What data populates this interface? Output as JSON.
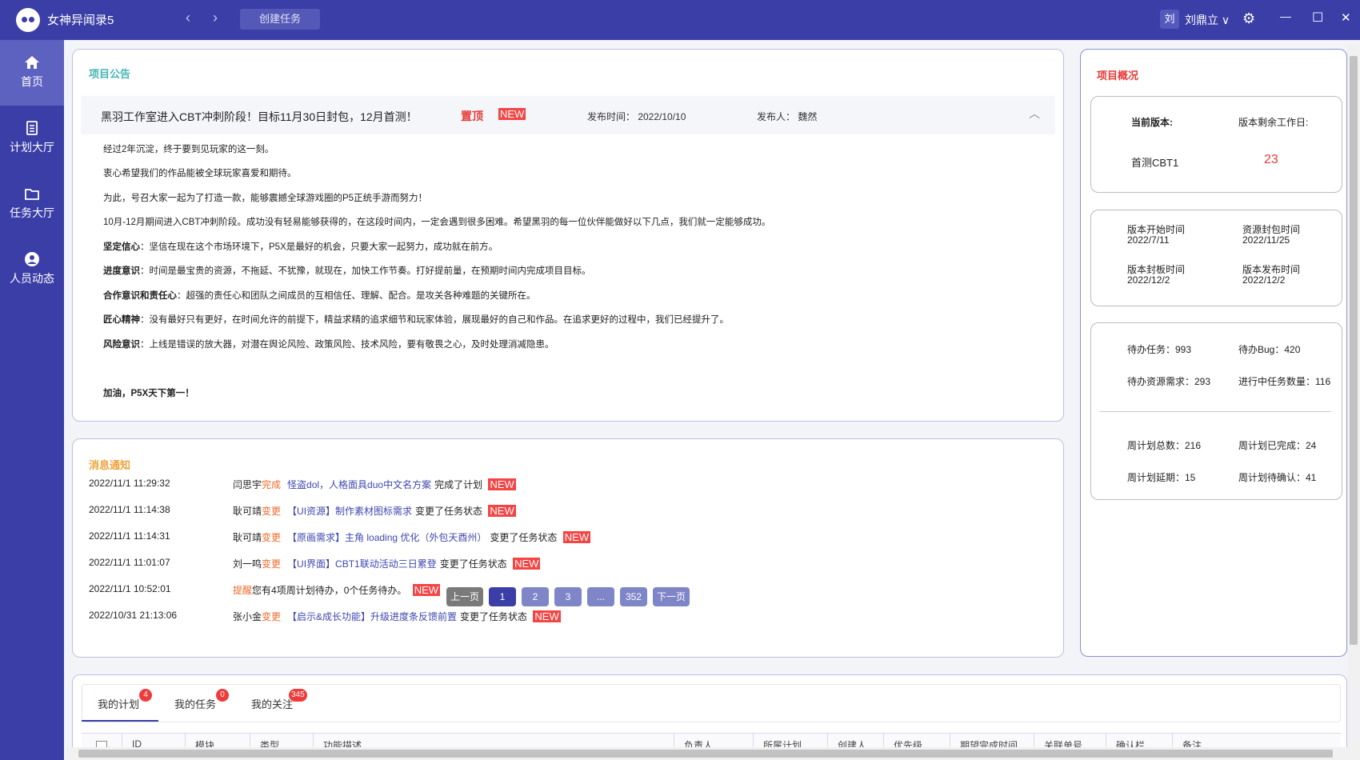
{
  "titlebar": {
    "app_title": "女神异闻录5",
    "back_arrow": "‹",
    "forward_arrow": "›",
    "create_task": "创建任务",
    "user_avatar": "刘",
    "user_name": "刘鼎立 ∨",
    "settings_glyph": "⚙",
    "minimize_glyph": "—",
    "maximize_glyph": "☐",
    "close_glyph": "✕"
  },
  "sidebar": {
    "items": [
      {
        "label": "首页"
      },
      {
        "label": "计划大厅"
      },
      {
        "label": "任务大厅"
      },
      {
        "label": "人员动态"
      }
    ]
  },
  "announcement": {
    "section_title": "项目公告",
    "title": "黑羽工作室进入CBT冲刺阶段！目标11月30日封包，12月首测！",
    "tag_top": "置顶",
    "tag_new": "NEW",
    "date": "发布时间：  2022/10/10",
    "author": "发布人：  魏然",
    "chevron": "︿",
    "lines": [
      {
        "bold": "",
        "text": "经过2年沉淀，终于要到见玩家的这一刻。"
      },
      {
        "bold": "",
        "text": "衷心希望我们的作品能被全球玩家喜爱和期待。"
      },
      {
        "bold": "",
        "text": "为此，号召大家一起为了打造一款，能够震撼全球游戏圈的P5正统手游而努力！"
      },
      {
        "bold": "",
        "text": "10月-12月期间进入CBT冲刺阶段。成功没有轻易能够获得的，在这段时间内，一定会遇到很多困难。希望黑羽的每一位伙伴能做好以下几点，我们就一定能够成功。"
      },
      {
        "bold": "坚定信心",
        "text": "：坚信在现在这个市场环境下，P5X是最好的机会，只要大家一起努力，成功就在前方。"
      },
      {
        "bold": "进度意识",
        "text": "：时间是最宝贵的资源，不拖延、不犹豫，就现在，加快工作节奏。打好提前量，在预期时间内完成项目目标。"
      },
      {
        "bold": "合作意识和责任心",
        "text": "：超强的责任心和团队之间成员的互相信任、理解、配合。是攻关各种难题的关键所在。"
      },
      {
        "bold": "匠心精神",
        "text": "：没有最好只有更好，在时间允许的前提下，精益求精的追求细节和玩家体验，展现最好的自己和作品。在追求更好的过程中，我们已经提升了。"
      },
      {
        "bold": "风险意识",
        "text": "：上线是错误的放大器，对潜在舆论风险、政策风险、技术风险，要有敬畏之心，及时处理消减隐患。"
      }
    ],
    "closing": "加油，P5X天下第一！"
  },
  "messages": {
    "section_title": "消息通知",
    "rows": [
      {
        "time": "2022/11/1 11:29:32",
        "user": "闫思宇",
        "action": "完成",
        "link": "怪盗dol，人格面具duo中文名方案",
        "result": "完成了计划",
        "badge": "NEW"
      },
      {
        "time": "2022/11/1 11:14:38",
        "user": "耿可靖",
        "action": "变更",
        "link": "【UI资源】制作素材图标需求",
        "result": "变更了任务状态",
        "badge": "NEW"
      },
      {
        "time": "2022/11/1 11:14:31",
        "user": "耿可靖",
        "action": "变更",
        "link": "【原画需求】主角 loading 优化（外包天酉州）",
        "result": "变更了任务状态",
        "badge": "NEW"
      },
      {
        "time": "2022/11/1 11:01:07",
        "user": "刘一鸣",
        "action": "变更",
        "link": "【UI界面】CBT1联动活动三日累登",
        "result": "变更了任务状态",
        "badge": "NEW"
      },
      {
        "time": "2022/11/1 10:52:01",
        "user": "",
        "action": "提醒",
        "link": "",
        "result": "您有4项周计划待办，0个任务待办。",
        "badge": "NEW"
      },
      {
        "time": "2022/10/31 21:13:06",
        "user": "张小金",
        "action": "变更",
        "link": "【启示&成长功能】升级进度条反馈前置",
        "result": "变更了任务状态",
        "badge": "NEW"
      }
    ],
    "pagination": [
      "上一页",
      "1",
      "2",
      "3",
      "...",
      "352",
      "下一页"
    ]
  },
  "overview": {
    "section_title": "项目概况",
    "current_version_label": "当前版本:",
    "remaining_label": "版本剩余工作日:",
    "current_version": "首测CBT1",
    "remaining_days": "23",
    "dates": [
      {
        "label": "版本开始时间",
        "value": "2022/7/11"
      },
      {
        "label": "资源封包时间",
        "value": "2022/11/25"
      },
      {
        "label": "版本封板时间",
        "value": "2022/12/2"
      },
      {
        "label": "版本发布时间",
        "value": "2022/12/2"
      }
    ],
    "stats": [
      "待办任务：993",
      "待办Bug：420",
      "待办资源需求：293",
      "进行中任务数量：116",
      "周计划总数：216",
      "周计划已完成：24",
      "周计划延期：15",
      "周计划待确认：41"
    ]
  },
  "tabs": [
    {
      "label": "我的计划",
      "count": "4"
    },
    {
      "label": "我的任务",
      "count": "0"
    },
    {
      "label": "我的关注",
      "count": "345"
    }
  ],
  "table_headers": [
    "ID",
    "模块",
    "类型",
    "功能描述",
    "负责人",
    "所属计划",
    "创建人",
    "优先级",
    "期望完成时间",
    "关联单号",
    "确认栏",
    "备注"
  ],
  "colors": {
    "brand": "#3a3ea6",
    "accent_teal": "#46b5b5",
    "accent_orange": "#f0a23a",
    "accent_red": "#e53935",
    "link": "#3f47b0"
  }
}
